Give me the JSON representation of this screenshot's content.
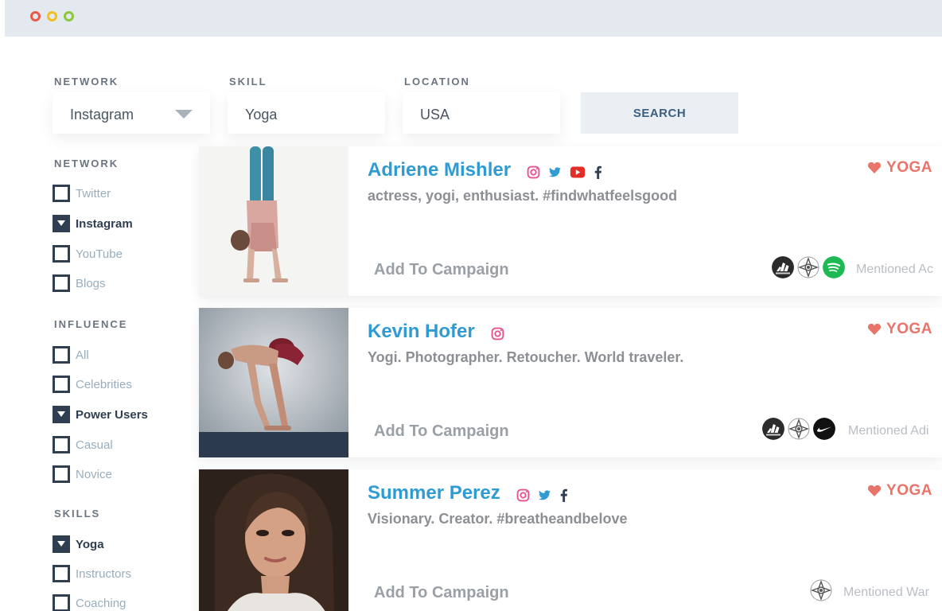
{
  "window": {
    "controls": [
      "close",
      "minimize",
      "zoom"
    ]
  },
  "search": {
    "network_label": "NETWORK",
    "network_value": "Instagram",
    "skill_label": "SKILL",
    "skill_value": "Yoga",
    "location_label": "LOCATION",
    "location_value": "USA",
    "button_label": "SEARCH"
  },
  "filters": {
    "network": {
      "heading": "NETWORK",
      "options": [
        {
          "label": "Twitter",
          "checked": false
        },
        {
          "label": "Instagram",
          "checked": true
        },
        {
          "label": "YouTube",
          "checked": false
        },
        {
          "label": "Blogs",
          "checked": false
        }
      ]
    },
    "influence": {
      "heading": "INFLUENCE",
      "options": [
        {
          "label": "All",
          "checked": false
        },
        {
          "label": "Celebrities",
          "checked": false
        },
        {
          "label": "Power Users",
          "checked": true
        },
        {
          "label": "Casual",
          "checked": false
        },
        {
          "label": "Novice",
          "checked": false
        }
      ]
    },
    "skills": {
      "heading": "SKILLS",
      "options": [
        {
          "label": "Yoga",
          "checked": true
        },
        {
          "label": "Instructors",
          "checked": false
        },
        {
          "label": "Coaching",
          "checked": false
        }
      ]
    }
  },
  "results": [
    {
      "name": "Adriene Mishler",
      "bio": "actress, yogi, enthusiast. #findwhatfeelsgood",
      "socials": [
        "instagram-icon",
        "twitter-icon",
        "youtube-icon",
        "facebook-icon"
      ],
      "tag": "YOGA",
      "action": "Add To Campaign",
      "brands": [
        "adidas-logo",
        "compass-logo",
        "spotify-logo"
      ],
      "mentioned": "Mentioned Ac"
    },
    {
      "name": "Kevin Hofer",
      "bio": "Yogi. Photographer. Retoucher. World traveler.",
      "socials": [
        "instagram-icon"
      ],
      "tag": "YOGA",
      "action": "Add To Campaign",
      "brands": [
        "adidas-logo",
        "compass-logo",
        "nike-logo"
      ],
      "mentioned": "Mentioned Adi"
    },
    {
      "name": "Summer Perez",
      "bio": "Visionary. Creator. #breatheandbelove",
      "socials": [
        "instagram-icon",
        "twitter-icon",
        "facebook-icon"
      ],
      "tag": "YOGA",
      "action": "Add To Campaign",
      "brands": [
        "compass-logo"
      ],
      "mentioned": "Mentioned War"
    }
  ],
  "colors": {
    "accent": "#2e9bd2",
    "tag": "#e8746a",
    "checkbox": "#2f3e50",
    "titlebar": "#e4e9ef"
  }
}
